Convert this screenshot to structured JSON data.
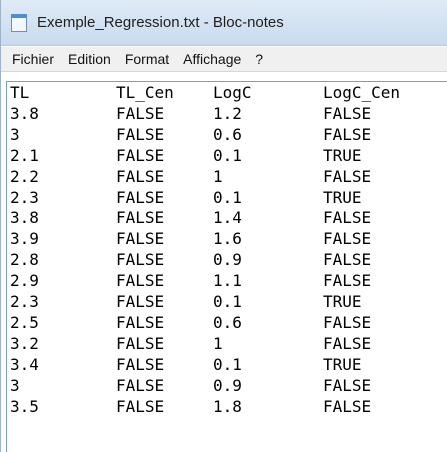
{
  "window": {
    "title": "Exemple_Regression.txt - Bloc-notes",
    "icon": "notepad-icon"
  },
  "menu": {
    "items": [
      "Fichier",
      "Edition",
      "Format",
      "Affichage",
      "?"
    ]
  },
  "document": {
    "header": [
      "TL",
      "TL_Cen",
      "LogC",
      "LogC_Cen"
    ],
    "rows": [
      [
        "3.8",
        "FALSE",
        "1.2",
        "FALSE"
      ],
      [
        "3",
        "FALSE",
        "0.6",
        "FALSE"
      ],
      [
        "2.1",
        "FALSE",
        "0.1",
        "TRUE"
      ],
      [
        "2.2",
        "FALSE",
        "1",
        "FALSE"
      ],
      [
        "2.3",
        "FALSE",
        "0.1",
        "TRUE"
      ],
      [
        "3.8",
        "FALSE",
        "1.4",
        "FALSE"
      ],
      [
        "3.9",
        "FALSE",
        "1.6",
        "FALSE"
      ],
      [
        "2.8",
        "FALSE",
        "0.9",
        "FALSE"
      ],
      [
        "2.9",
        "FALSE",
        "1.1",
        "FALSE"
      ],
      [
        "2.3",
        "FALSE",
        "0.1",
        "TRUE"
      ],
      [
        "2.5",
        "FALSE",
        "0.6",
        "FALSE"
      ],
      [
        "3.2",
        "FALSE",
        "1",
        "FALSE"
      ],
      [
        "3.4",
        "FALSE",
        "0.1",
        "TRUE"
      ],
      [
        "3",
        "FALSE",
        "0.9",
        "FALSE"
      ],
      [
        "3.5",
        "FALSE",
        "1.8",
        "FALSE"
      ]
    ]
  }
}
